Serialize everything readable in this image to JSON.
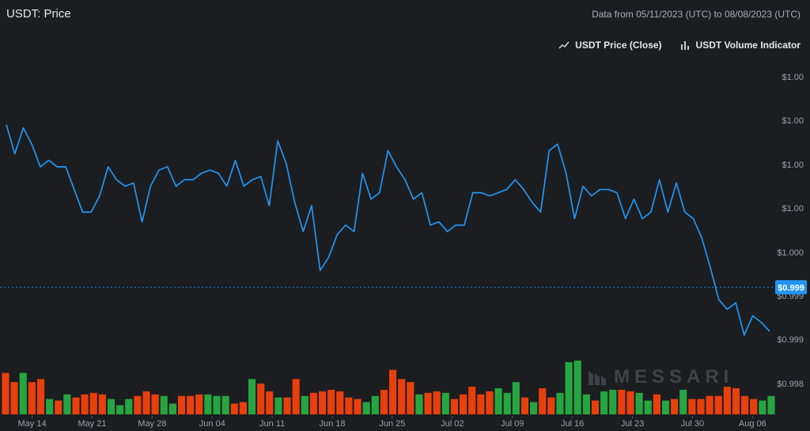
{
  "header": {
    "title": "USDT: Price",
    "date_range": "Data from 05/11/2023 (UTC) to 08/08/2023 (UTC)"
  },
  "legend": {
    "price_label": "USDT Price (Close)",
    "volume_label": "USDT Volume Indicator"
  },
  "watermark": {
    "text": "MESSARI"
  },
  "colors": {
    "background": "#1c1d21",
    "price_line": "#2196f3",
    "volume_up": "#26a641",
    "volume_down": "#e8400c",
    "current_label_bg": "#2196f3"
  },
  "chart_data": {
    "type": "line",
    "title": "USDT: Price",
    "start_date": "2023-05-11",
    "end_date": "2023-08-08",
    "x_tick_labels": [
      "May 14",
      "May 21",
      "May 28",
      "Jun 04",
      "Jun 11",
      "Jun 18",
      "Jun 25",
      "Jul 02",
      "Jul 09",
      "Jul 16",
      "Jul 23",
      "Jul 30",
      "Aug 06"
    ],
    "y_tick_labels": [
      "$1.00",
      "$1.00",
      "$1.00",
      "$1.00",
      "$1.000",
      "$0.999",
      "$0.999",
      "$0.998"
    ],
    "current_value_label": "$0.999",
    "current_value": 0.99917,
    "ylim": [
      0.99805,
      1.00275
    ],
    "series": [
      {
        "name": "USDT Price (Close)",
        "values": [
          1.00168,
          1.00123,
          1.00163,
          1.00138,
          1.00103,
          1.00113,
          1.00103,
          1.00103,
          1.00068,
          1.00033,
          1.00033,
          1.00058,
          1.00103,
          1.00083,
          1.00073,
          1.00078,
          1.00018,
          1.00073,
          1.00098,
          1.00103,
          1.00073,
          1.00083,
          1.00083,
          1.00093,
          1.00098,
          1.00093,
          1.00073,
          1.00113,
          1.00073,
          1.00083,
          1.00088,
          1.00043,
          1.00143,
          1.00108,
          1.00048,
          1.00003,
          1.00043,
          0.99943,
          0.99963,
          0.99998,
          1.00013,
          1.00003,
          1.00093,
          1.00053,
          1.00063,
          1.00128,
          1.00103,
          1.00083,
          1.00053,
          1.00063,
          1.00013,
          1.00018,
          1.00003,
          1.00013,
          1.00013,
          1.00063,
          1.00063,
          1.00058,
          1.00063,
          1.00068,
          1.00083,
          1.00068,
          1.00048,
          1.00033,
          1.00128,
          1.00138,
          1.00093,
          1.00023,
          1.00073,
          1.00058,
          1.00068,
          1.00068,
          1.00063,
          1.00023,
          1.00053,
          1.00023,
          1.00033,
          1.00083,
          1.00033,
          1.00078,
          1.00033,
          1.00023,
          0.99993,
          0.99948,
          0.99898,
          0.99883,
          0.99893,
          0.99843,
          0.99873,
          0.99863,
          0.99849
        ]
      }
    ],
    "volume": {
      "name": "USDT Volume Indicator",
      "values": [
        27,
        21,
        27,
        21,
        23,
        10,
        9,
        13,
        11,
        13,
        14,
        13,
        10,
        6,
        10,
        12,
        15,
        13,
        12,
        7,
        12,
        12,
        13,
        13,
        12,
        12,
        7,
        8,
        23,
        20,
        15,
        11,
        11,
        23,
        12,
        14,
        15,
        16,
        15,
        11,
        10,
        8,
        12,
        16,
        29,
        23,
        21,
        13,
        14,
        15,
        14,
        10,
        13,
        18,
        13,
        15,
        17,
        14,
        21,
        11,
        8,
        17,
        11,
        14,
        34,
        35,
        13,
        9,
        15,
        16,
        16,
        15,
        14,
        9,
        13,
        9,
        10,
        16,
        10,
        10,
        12,
        12,
        18,
        17,
        12,
        10,
        9,
        12
      ],
      "up": [
        false,
        false,
        true,
        false,
        false,
        true,
        false,
        true,
        false,
        false,
        false,
        false,
        true,
        true,
        true,
        false,
        false,
        false,
        true,
        true,
        false,
        false,
        false,
        true,
        true,
        true,
        false,
        false,
        true,
        false,
        false,
        true,
        false,
        false,
        true,
        false,
        false,
        false,
        false,
        false,
        false,
        true,
        true,
        false,
        false,
        false,
        false,
        true,
        false,
        false,
        true,
        false,
        false,
        false,
        false,
        false,
        true,
        true,
        true,
        false,
        true,
        false,
        false,
        true,
        true,
        true,
        true,
        false,
        true,
        true,
        false,
        false,
        true,
        true,
        false,
        true,
        false,
        true,
        false,
        false,
        false,
        false,
        false,
        false,
        false,
        false,
        true,
        true
      ]
    }
  }
}
